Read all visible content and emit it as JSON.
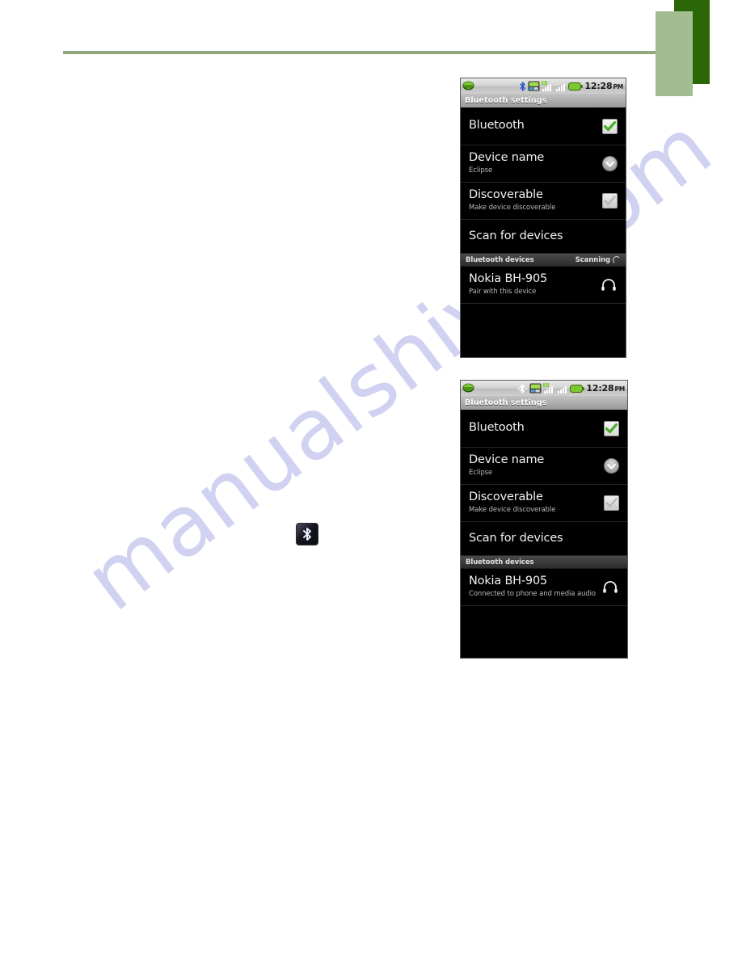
{
  "page": {
    "background_color": "#ffffff",
    "rule_color": "#8fa87e",
    "deco_dark_green": "#2b6707",
    "deco_light_green": "#a3bd92",
    "watermark_text": "manualshive.com",
    "watermark_color": "#c9c9ef"
  },
  "inline_icon": {
    "name": "bluetooth-badge-icon",
    "glyph": "ᛦ"
  },
  "screenshots": [
    {
      "id": "phone-screenshot-scanning",
      "statusbar": {
        "notification_icon": "message-bubble-icon",
        "icons": [
          "bluetooth-icon",
          "sync-icon",
          "signal-bars-icon",
          "signal-bars-secondary-icon",
          "battery-icon"
        ],
        "clock": "12:28",
        "ampm": "PM"
      },
      "titlebar": {
        "title": "Bluetooth settings"
      },
      "rows": [
        {
          "name": "bluetooth-toggle-row",
          "title": "Bluetooth",
          "subtitle": "",
          "widget": "checkbox-checked"
        },
        {
          "name": "device-name-row",
          "title": "Device name",
          "subtitle": "Eclipse",
          "widget": "chevron-down"
        },
        {
          "name": "discoverable-row",
          "title": "Discoverable",
          "subtitle": "Make device discoverable",
          "widget": "checkbox-unchecked"
        },
        {
          "name": "scan-for-devices-row",
          "title": "Scan for devices",
          "subtitle": "",
          "widget": "none"
        }
      ],
      "section": {
        "label": "Bluetooth devices",
        "status": "Scanning",
        "has_spinner": true
      },
      "devices": [
        {
          "name": "device-row-nokia",
          "title": "Nokia BH-905",
          "subtitle": "Pair with this device",
          "widget": "headset-icon"
        }
      ]
    },
    {
      "id": "phone-screenshot-connected",
      "statusbar": {
        "notification_icon": "message-bubble-icon",
        "icons": [
          "bluetooth-connected-icon",
          "sync-icon",
          "signal-bars-icon",
          "signal-bars-secondary-icon",
          "battery-icon"
        ],
        "clock": "12:28",
        "ampm": "PM"
      },
      "titlebar": {
        "title": "Bluetooth settings"
      },
      "rows": [
        {
          "name": "bluetooth-toggle-row",
          "title": "Bluetooth",
          "subtitle": "",
          "widget": "checkbox-checked"
        },
        {
          "name": "device-name-row",
          "title": "Device name",
          "subtitle": "Eclipse",
          "widget": "chevron-down"
        },
        {
          "name": "discoverable-row",
          "title": "Discoverable",
          "subtitle": "Make device discoverable",
          "widget": "checkbox-unchecked"
        },
        {
          "name": "scan-for-devices-row",
          "title": "Scan for devices",
          "subtitle": "",
          "widget": "none"
        }
      ],
      "section": {
        "label": "Bluetooth devices",
        "status": "",
        "has_spinner": false
      },
      "devices": [
        {
          "name": "device-row-nokia",
          "title": "Nokia BH-905",
          "subtitle": "Connected to phone and media audio",
          "widget": "headset-icon"
        }
      ]
    }
  ]
}
